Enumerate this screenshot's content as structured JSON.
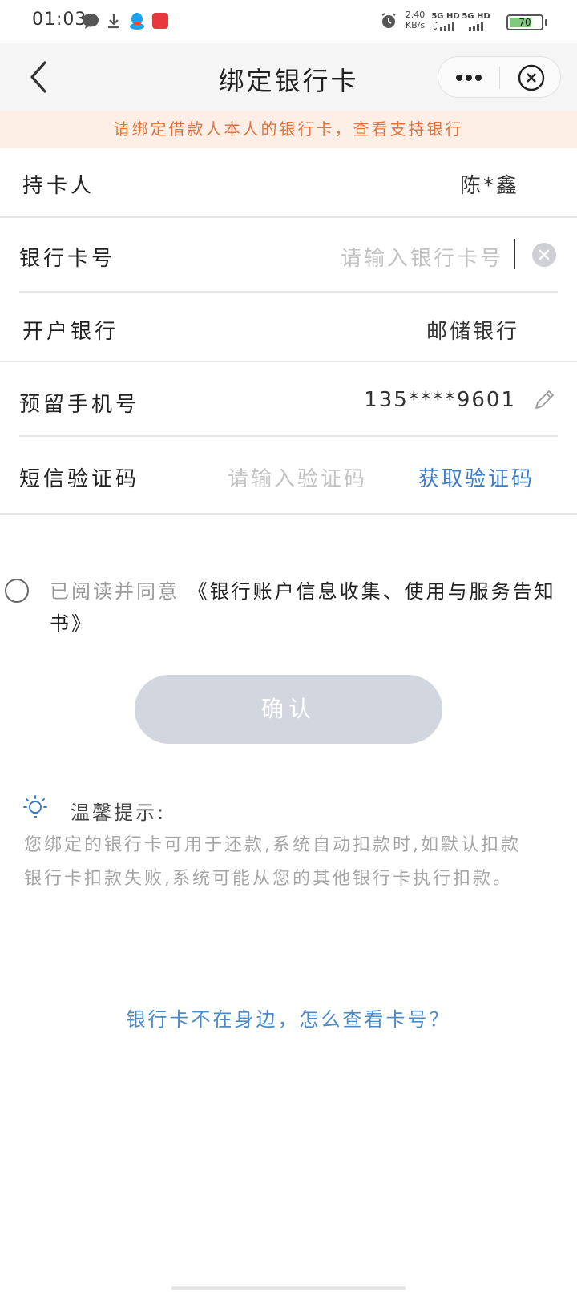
{
  "status_bar": {
    "time": "01:03",
    "net_speed_value": "2.40",
    "net_speed_unit": "KB/s",
    "sim1": "5G HD",
    "sim2": "5G HD",
    "battery": "70",
    "battery_level": 0.7,
    "icons": [
      "chat-bubble-icon",
      "download-icon",
      "qq-icon",
      "app-badge-icon",
      "alarm-icon",
      "signal-icon",
      "battery-icon"
    ]
  },
  "nav": {
    "title": "绑定银行卡"
  },
  "notice": {
    "text": "请绑定借款人本人的银行卡，查看支持银行"
  },
  "form": {
    "cardholder": {
      "label": "持卡人",
      "value": "陈*鑫"
    },
    "card_number": {
      "label": "银行卡号",
      "placeholder": "请输入银行卡号"
    },
    "bank": {
      "label": "开户银行",
      "value": "邮储银行"
    },
    "phone": {
      "label": "预留手机号",
      "value": "135****9601"
    },
    "sms": {
      "label": "短信验证码",
      "placeholder": "请输入验证码",
      "button": "获取验证码"
    }
  },
  "agreement": {
    "prefix": "已阅读并同意",
    "link": "《银行账户信息收集、使用与服务告知书》"
  },
  "confirm_button": "确认",
  "tip": {
    "title": "温馨提示:",
    "body": "您绑定的银行卡可用于还款,系统自动扣款时,如默认扣款银行卡扣款失败,系统可能从您的其他银行卡执行扣款。"
  },
  "help_link": "银行卡不在身边，怎么查看卡号？",
  "colors": {
    "accent_blue": "#3d7cc9",
    "notice_text": "#e0733e",
    "notice_bg": "#fdeee6",
    "button_disabled": "#d2d6df"
  }
}
